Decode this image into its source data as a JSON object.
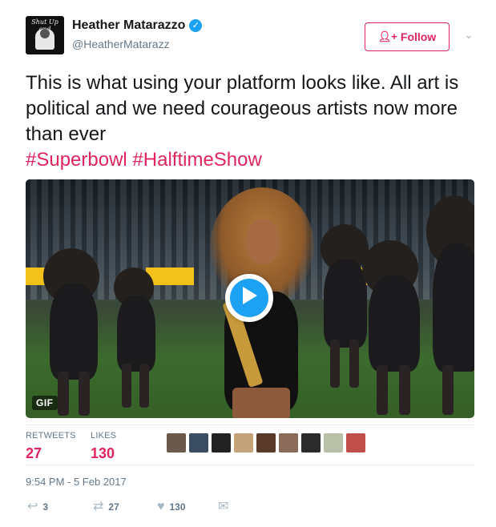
{
  "author": {
    "name": "Heather Matarazzo",
    "handle": "@HeatherMatarazz",
    "avatar_text": "Shut Up and Listen"
  },
  "follow_button": {
    "label": "Follow",
    "icon": "add-user-icon"
  },
  "menu_icon": "chevron-down-icon",
  "tweet": {
    "text": "This is what using your platform looks like. All art is political and we need courageous artists now more than ever",
    "hashtags": [
      "#Superbowl",
      "#HalftimeShow"
    ]
  },
  "media": {
    "badge": "GIF",
    "play_icon": "play-icon"
  },
  "stats": {
    "retweets_label": "RETWEETS",
    "retweets_value": "27",
    "likes_label": "LIKES",
    "likes_value": "130"
  },
  "likers": [
    {
      "color": "#6a5a4c"
    },
    {
      "color": "#3a4d63"
    },
    {
      "color": "#222222"
    },
    {
      "color": "#c4a37a"
    },
    {
      "color": "#5a3a2a"
    },
    {
      "color": "#8a6a58"
    },
    {
      "color": "#2b2b2b"
    },
    {
      "color": "#b9c2a8"
    },
    {
      "color": "#c2504a"
    }
  ],
  "timestamp": "9:54 PM - 5 Feb 2017",
  "actions": {
    "reply": {
      "icon": "reply-icon",
      "count": "3"
    },
    "retweet": {
      "icon": "retweet-icon",
      "count": "27"
    },
    "like": {
      "icon": "heart-icon",
      "count": "130"
    },
    "message": {
      "icon": "direct-message-icon"
    }
  },
  "colors": {
    "accent": "#e0245e",
    "verified": "#1da1f2",
    "muted": "#657786",
    "play": "#1da1f2"
  }
}
